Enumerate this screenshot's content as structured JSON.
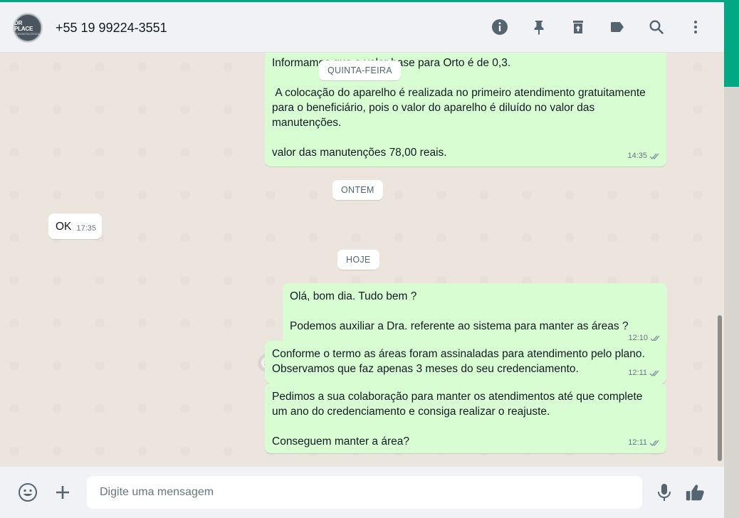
{
  "header": {
    "avatar_line1": "DR PLACE",
    "avatar_line2": "ODONTOLÓGICA",
    "contact": "+55 19 99224-3551",
    "icons": [
      "info-icon",
      "pin-icon",
      "archive-icon",
      "label-icon",
      "search-icon",
      "menu-icon"
    ]
  },
  "messages": {
    "m1": {
      "text": "Informamos que o valor base para Orto é de 0,3.\n\n A colocação do aparelho é realizada no primeiro atendimento gratuitamente para o beneficiário, pois o valor do aparelho é diluído no valor das manutenções.\n\nvalor das manutenções 78,00 reais.",
      "time": "14:35"
    },
    "m2": {
      "text": "OK",
      "time": "17:35"
    },
    "m3": {
      "text": "Olá, bom dia. Tudo bem ?\n\nPodemos auxiliar a Dra. referente ao sistema para manter as áreas ?",
      "time": "12:10"
    },
    "m4": {
      "text": "Conforme o termo as áreas foram assinaladas para atendimento pelo plano. Observamos que faz apenas 3 meses do seu credenciamento.",
      "time": "12:11"
    },
    "m5": {
      "text": "Pedimos a sua colaboração para manter os atendimentos até que complete um ano do credenciamento e consiga realizar o reajuste.\n\nConseguem manter a área?",
      "time": "12:11"
    }
  },
  "dates": {
    "d1": "QUINTA-FEIRA",
    "d2": "ONTEM",
    "d3": "HOJE"
  },
  "composer": {
    "placeholder": "Digite uma mensagem"
  },
  "colors": {
    "accent": "#00a884",
    "outgoing": "#d9fdd3",
    "incoming": "#ffffff",
    "ticks": "#8696a0"
  }
}
